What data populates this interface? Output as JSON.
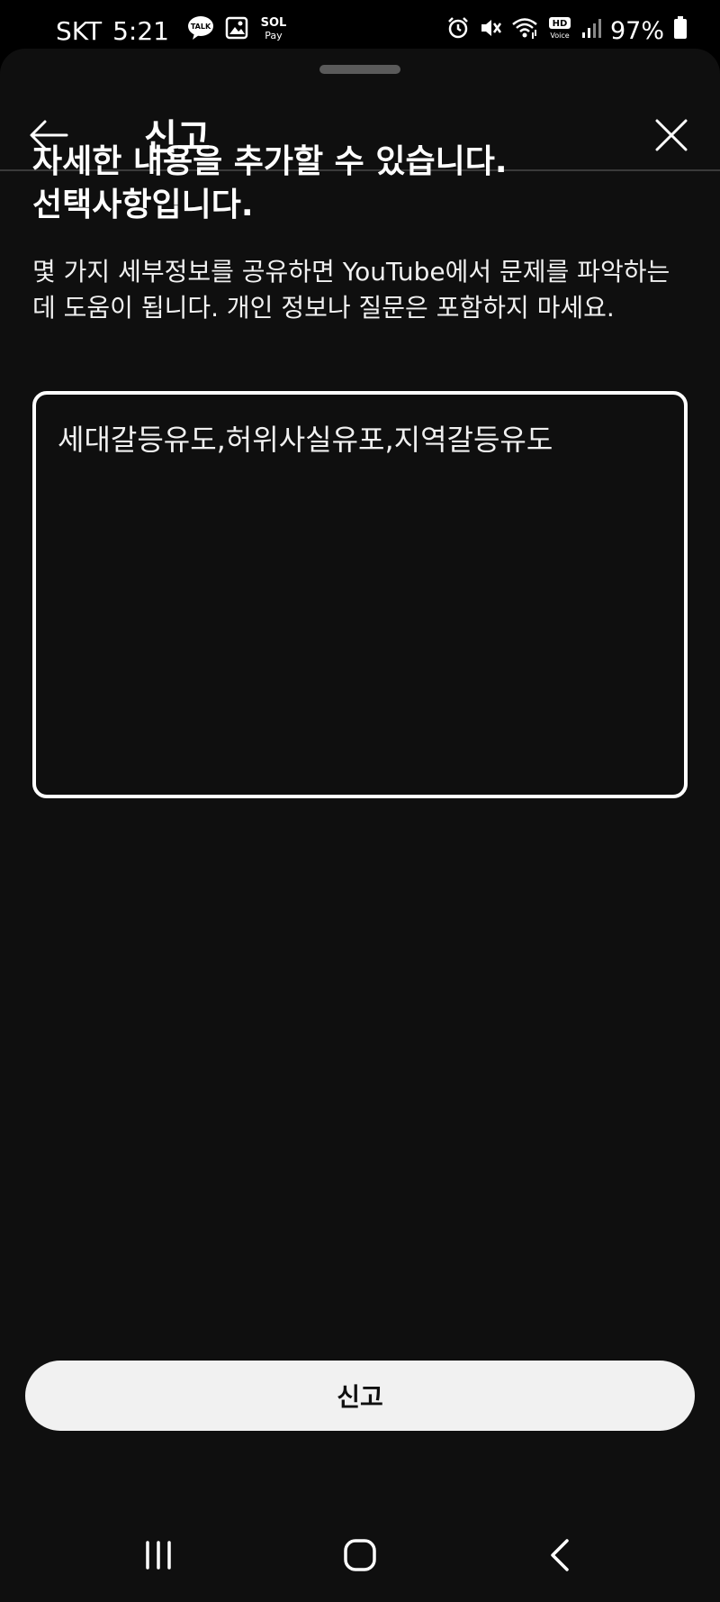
{
  "status_bar": {
    "carrier": "SKT",
    "time": "5:21",
    "battery": "97%",
    "left_icons": [
      "talk-icon",
      "gallery-icon",
      "sol-pay-icon"
    ],
    "right_icons": [
      "alarm-icon",
      "mute-icon",
      "wifi-icon",
      "hd-voice-icon",
      "signal-icon",
      "battery-icon"
    ],
    "talk_label": "TALK",
    "sol_label": "SOL",
    "pay_label": "Pay",
    "hd_label": "HD",
    "voice_label": "Voice"
  },
  "header": {
    "title": "신고",
    "back_icon": "back-arrow-icon",
    "close_icon": "close-icon"
  },
  "content": {
    "heading": "자세한 내용을 추가할 수 있습니다.\n선택사항입니다.",
    "description": "몇 가지 세부정보를 공유하면 YouTube에서 문제를 파악하는 데 도움이 됩니다. 개인 정보나 질문은 포함하지 마세요.",
    "details_value": "세대갈등유도,허위사실유포,지역갈등유도"
  },
  "submit": {
    "label": "신고"
  },
  "nav_bar": {
    "icons": [
      "recents-icon",
      "home-icon",
      "back-icon"
    ]
  },
  "colors": {
    "background": "#0f0f0f",
    "text": "#ffffff",
    "button_bg": "#f1f1f1",
    "button_text": "#0f0f0f"
  }
}
